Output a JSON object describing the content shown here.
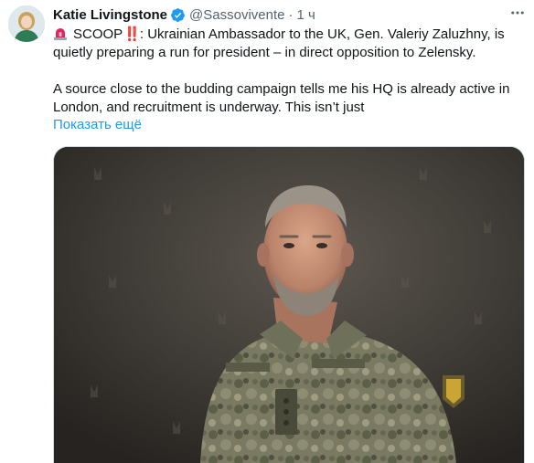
{
  "tweet": {
    "author_name": "Katie Livingstone",
    "handle": "@Sassovivente",
    "separator": "·",
    "time": "1 ч",
    "verified_icon": "verified-badge-icon",
    "more_icon": "more-options-icon",
    "paragraph1_scoop": "SCOOP",
    "paragraph1_bang": "‼️",
    "paragraph1_text": ": Ukrainian Ambassador to the UK, Gen. Valeriy Zaluzhny, is quietly preparing a run for president – in direct opposition to Zelensky.",
    "paragraph2_text": "A source close to the budding campaign tells me his HQ is already active in London, and recruitment is underway. This isn’t just",
    "show_more": "Показать ещё",
    "media_description_icon": "tweet-photo"
  },
  "colors": {
    "accent": "#1d9bf0",
    "text": "#0f1419",
    "secondary": "#536471",
    "siren": "#e0245e"
  }
}
